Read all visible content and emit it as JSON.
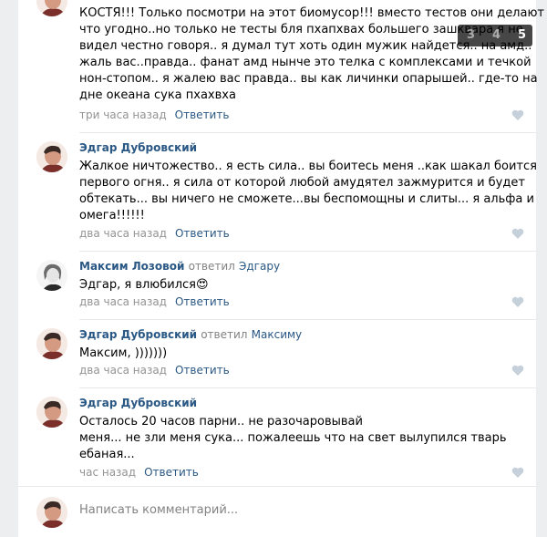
{
  "comments": [
    {
      "author": "",
      "lines": [
        "КОСТЯ!!! Только посмотри на этот биомусор!!! вместо тестов они делают",
        "что угодно..но только не тесты бля пхапхвах большего зашквара я не",
        "видел честно говоря.. я думал тут хоть один мужик найдется.. на амд..",
        "жаль вас..правда.. фанат амд нынче это телка с комплексами и течкой",
        "нон-стопом.. я жалею вас правда.. вы как личинки опарышей.. где-то на",
        "дне океана сука пхахвха"
      ],
      "time": "три часа назад",
      "reply_label": "Ответить"
    },
    {
      "author": "Эдгар Дубровский",
      "lines": [
        "Жалкое ничтожество.. я есть сила.. вы боитесь меня ..как шакал боится",
        "первого огня.. я сила от которой любой амудятел зажмурится и будет",
        "обтекать... вы ничего не сможете...вы беспомощны и слиты... я альфа и",
        "омега!!!!!!"
      ],
      "time": "два часа назад",
      "reply_label": "Ответить"
    },
    {
      "author": "Максим Лозовой",
      "replied_word": "ответил",
      "reply_to": "Эдгару",
      "lines": [
        "Эдгар, я влюбился😍"
      ],
      "time": "два часа назад",
      "reply_label": "Ответить"
    },
    {
      "author": "Эдгар Дубровский",
      "replied_word": "ответил",
      "reply_to": "Максиму",
      "lines": [
        "Максим, )))))))"
      ],
      "time": "два часа назад",
      "reply_label": "Ответить"
    },
    {
      "author": "Эдгар Дубровский",
      "lines": [
        "Осталось 20 часов парни.. не разочаровывай",
        "меня... не зли меня сука... пожалеешь что на свет вылупился тварь",
        "ебаная..."
      ],
      "time": "час назад",
      "reply_label": "Ответить"
    }
  ],
  "composer": {
    "placeholder": "Написать комментарий..."
  },
  "pager": {
    "pages": [
      "3",
      "4",
      "5"
    ],
    "current": "5"
  },
  "icons": {
    "like": "heart-icon"
  },
  "colors": {
    "link": "#2a5885",
    "muted": "#939393",
    "background": "#edeef0"
  }
}
